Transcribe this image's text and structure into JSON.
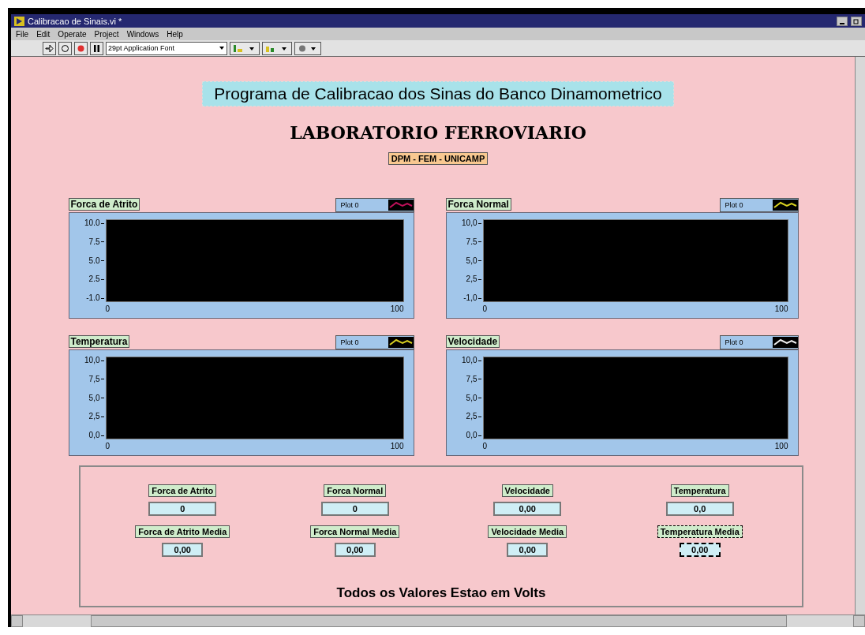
{
  "window": {
    "title": "Calibracao de Sinais.vi *"
  },
  "menu": [
    "File",
    "Edit",
    "Operate",
    "Project",
    "Windows",
    "Help"
  ],
  "toolbar": {
    "font_selector": "29pt Application Font"
  },
  "header": {
    "title": "Programa de Calibracao dos Sinas do Banco Dinamometrico",
    "subtitle": "LABORATORIO FERROVIARIO",
    "badge": "DPM - FEM - UNICAMP"
  },
  "graphs": [
    {
      "label": "Forca de Atrito",
      "legend": {
        "label": "Plot 0",
        "color": "#c0105a"
      },
      "y_ticks": [
        "10.0",
        "7.5",
        "5.0",
        "2.5",
        "-1.0"
      ],
      "x_ticks": [
        "0",
        "100"
      ]
    },
    {
      "label": "Forca Normal",
      "legend": {
        "label": "Plot 0",
        "color": "#d8d020"
      },
      "y_ticks": [
        "10,0",
        "7.5",
        "5,0",
        "2,5",
        "-1,0"
      ],
      "x_ticks": [
        "0",
        "100"
      ]
    },
    {
      "label": "Temperatura",
      "legend": {
        "label": "Plot 0",
        "color": "#d8d020"
      },
      "y_ticks": [
        "10,0",
        "7,5",
        "5,0",
        "2,5",
        "0,0"
      ],
      "x_ticks": [
        "0",
        "100"
      ]
    },
    {
      "label": "Velocidade",
      "legend": {
        "label": "Plot 0",
        "color": "#f0f0f0"
      },
      "y_ticks": [
        "10,0",
        "7,5",
        "5,0",
        "2,5",
        "0,0"
      ],
      "x_ticks": [
        "0",
        "100"
      ]
    }
  ],
  "indicators": [
    [
      {
        "label": "Forca de Atrito",
        "value": "0",
        "selected": false
      },
      {
        "label": "Forca de Atrito Media",
        "value": "0,00",
        "selected": false
      }
    ],
    [
      {
        "label": "Forca Normal",
        "value": "0",
        "selected": false
      },
      {
        "label": "Forca Normal Media",
        "value": "0,00",
        "selected": false
      }
    ],
    [
      {
        "label": "Velocidade",
        "value": "0,00",
        "selected": false
      },
      {
        "label": "Velocidade Media",
        "value": "0,00",
        "selected": false
      }
    ],
    [
      {
        "label": "Temperatura",
        "value": "0,0",
        "selected": false
      },
      {
        "label": "Temperatura Media",
        "value": "0,00",
        "selected": true
      }
    ]
  ],
  "footer": "Todos os Valores Estao em Volts"
}
